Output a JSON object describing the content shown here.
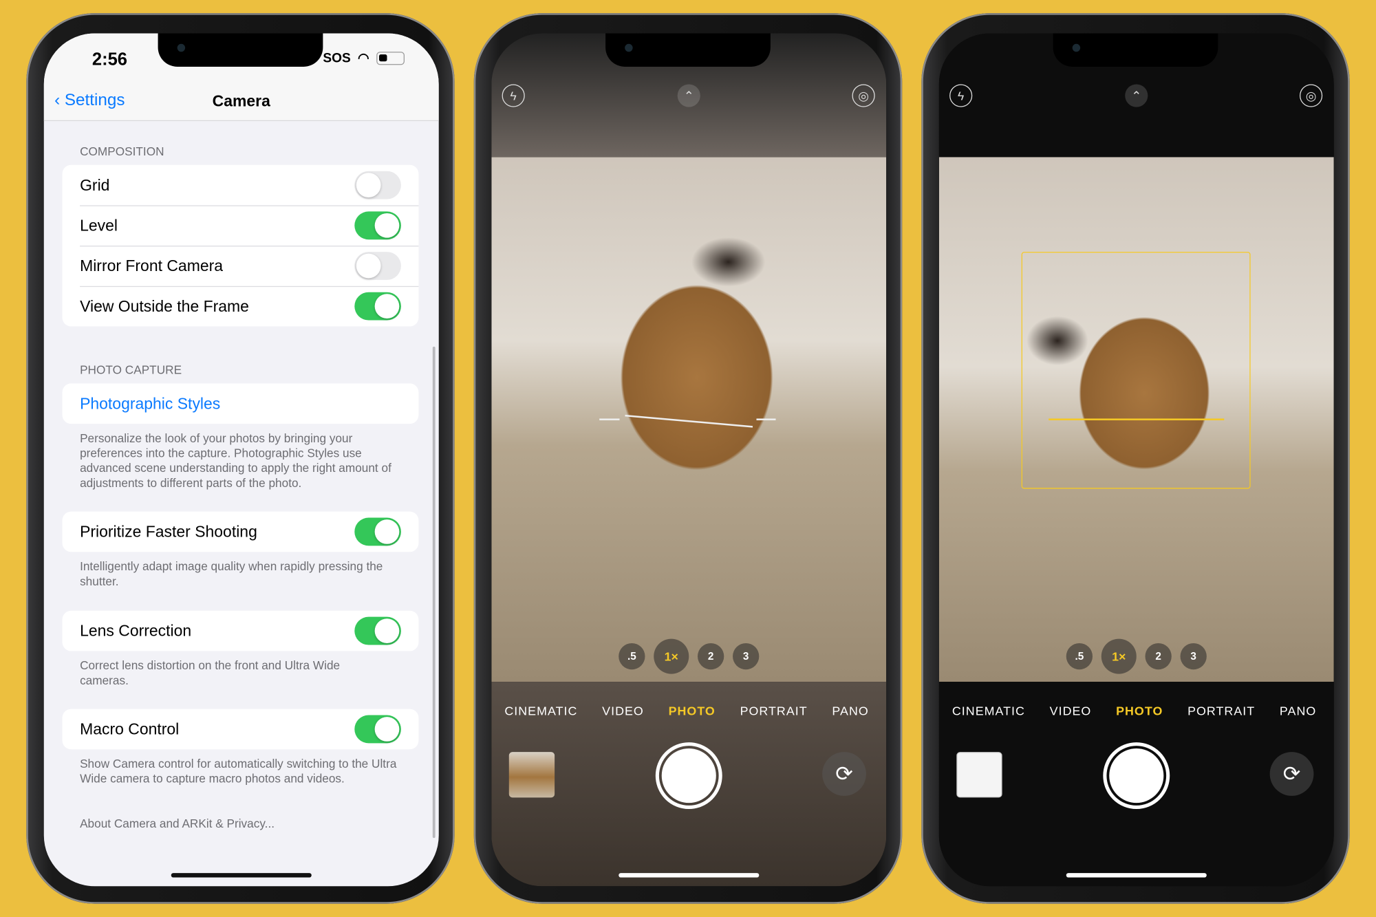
{
  "background_color": "#ecbf3f",
  "settings_screen": {
    "status": {
      "time": "2:56",
      "carrier": "SOS"
    },
    "nav": {
      "back_label": "Settings",
      "title": "Camera"
    },
    "composition": {
      "header": "COMPOSITION",
      "rows": [
        {
          "label": "Grid",
          "on": false
        },
        {
          "label": "Level",
          "on": true
        },
        {
          "label": "Mirror Front Camera",
          "on": false
        },
        {
          "label": "View Outside the Frame",
          "on": true
        }
      ]
    },
    "photo_capture": {
      "header": "PHOTO CAPTURE",
      "styles_label": "Photographic Styles",
      "styles_desc": "Personalize the look of your photos by bringing your preferences into the capture. Photographic Styles use advanced scene understanding to apply the right amount of adjustments to different parts of the photo."
    },
    "faster": {
      "label": "Prioritize Faster Shooting",
      "on": true,
      "desc": "Intelligently adapt image quality when rapidly pressing the shutter."
    },
    "lens": {
      "label": "Lens Correction",
      "on": true,
      "desc": "Correct lens distortion on the front and Ultra Wide cameras."
    },
    "macro": {
      "label": "Macro Control",
      "on": true,
      "desc": "Show Camera control for automatically switching to the Ultra Wide camera to capture macro photos and videos."
    },
    "privacy_link": "About Camera and ARKit & Privacy...",
    "toggle_on_color": "#34c759",
    "link_color": "#0a7aff"
  },
  "camera": {
    "zoom_options": [
      ".5",
      "1×",
      "2",
      "3"
    ],
    "selected_zoom": "1×",
    "modes": [
      "CINEMATIC",
      "VIDEO",
      "PHOTO",
      "PORTRAIT",
      "PANO"
    ],
    "selected_mode": "PHOTO",
    "accent_color": "#f5c926",
    "icons": {
      "flash": "flash-off-icon",
      "chevron": "chevron-up-icon",
      "live": "live-photo-icon",
      "flip": "camera-flip-icon"
    }
  }
}
